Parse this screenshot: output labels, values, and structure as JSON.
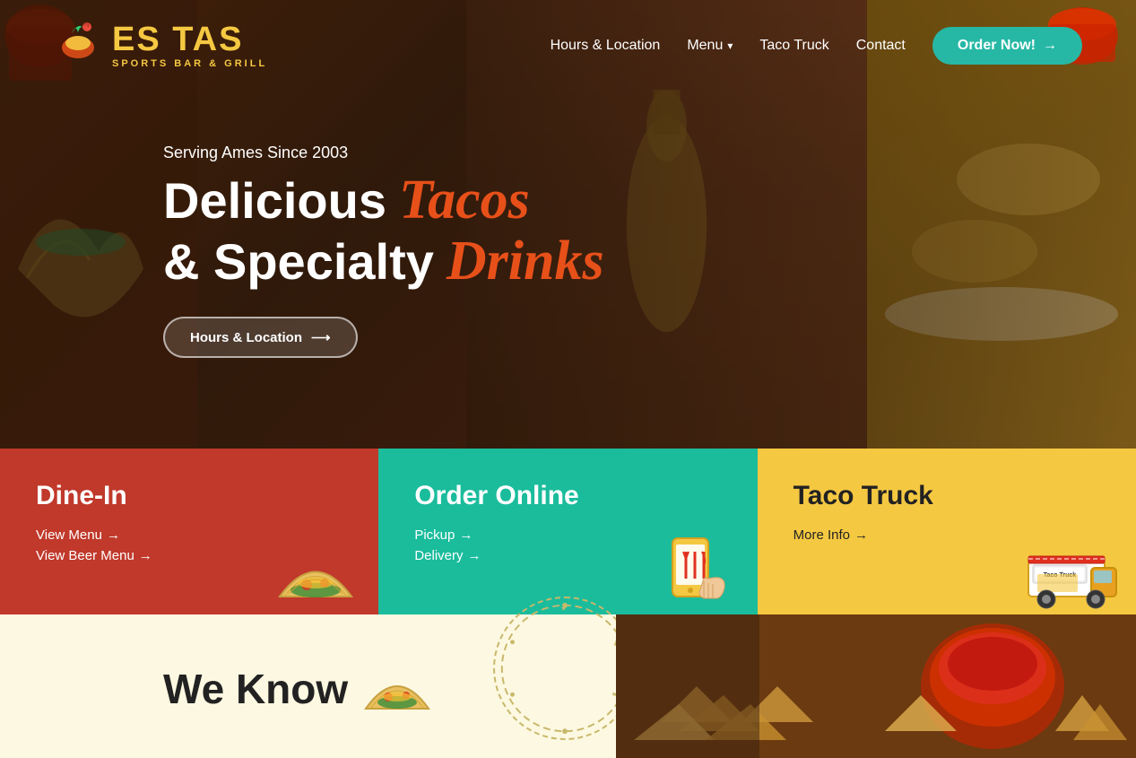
{
  "brand": {
    "name": "ES TAS",
    "tagline": "SPORTS BAR & GRILL",
    "logo_alt": "ES TAS logo"
  },
  "navbar": {
    "links": [
      {
        "id": "hours-location",
        "label": "Hours & Location"
      },
      {
        "id": "menu",
        "label": "Menu",
        "has_dropdown": true
      },
      {
        "id": "taco-truck",
        "label": "Taco Truck"
      },
      {
        "id": "contact",
        "label": "Contact"
      }
    ],
    "cta": {
      "label": "Order Now!",
      "arrow": "→"
    }
  },
  "hero": {
    "serving_text": "Serving Ames Since 2003",
    "title_part1": "Delicious",
    "title_tacos": "Tacos",
    "title_part2": "& Specialty",
    "title_drinks": "Drinks",
    "cta_label": "Hours & Location",
    "cta_arrow": "→"
  },
  "cards": [
    {
      "id": "dine-in",
      "title": "Dine-In",
      "links": [
        {
          "label": "View Menu",
          "arrow": "→"
        },
        {
          "label": "View Beer Menu",
          "arrow": "→"
        }
      ]
    },
    {
      "id": "order-online",
      "title": "Order Online",
      "links": [
        {
          "label": "Pickup",
          "arrow": "→"
        },
        {
          "label": "Delivery",
          "arrow": "→"
        }
      ]
    },
    {
      "id": "taco-truck",
      "title": "Taco Truck",
      "links": [
        {
          "label": "More Info",
          "arrow": "→"
        }
      ]
    }
  ],
  "bottom": {
    "we_know_title": "We Know"
  },
  "colors": {
    "brand_yellow": "#f5c842",
    "teal": "#1abc9c",
    "red": "#c0392b",
    "orange_italic": "#e8501a",
    "dark_text": "#222222"
  }
}
